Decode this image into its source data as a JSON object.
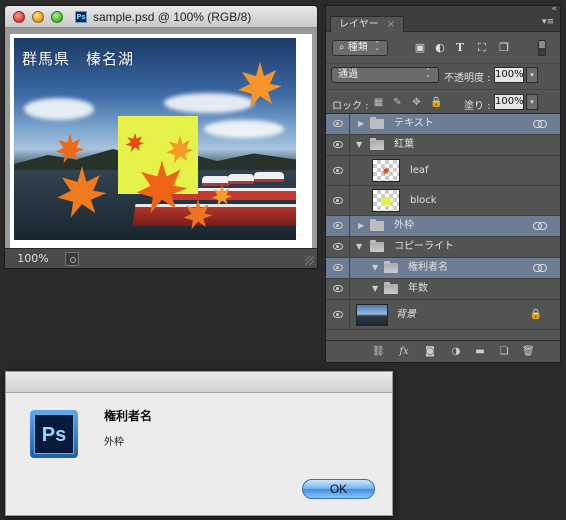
{
  "document_window": {
    "title": "sample.psd @ 100% (RGB/8)",
    "ps_icon_text": "Ps",
    "canvas_caption": "群馬県　榛名湖",
    "zoom": "100%"
  },
  "layers_panel": {
    "tab_label": "レイヤー",
    "tab_close": "×",
    "collapse_label": "«",
    "menu_label": "▾≡",
    "filter_kind": "種類",
    "blend_mode": "通過",
    "opacity_label": "不透明度 :",
    "opacity_value": "100%",
    "lock_label": "ロック :",
    "fill_label": "塗り :",
    "fill_value": "100%",
    "layers": [
      {
        "name": "テキスト",
        "type": "group",
        "expanded": false,
        "selected": true,
        "linked": true
      },
      {
        "name": "紅葉",
        "type": "group",
        "expanded": true,
        "selected": false,
        "linked": false
      },
      {
        "name": "leaf",
        "type": "layer",
        "thumbnail": "leaf-thumb-icon"
      },
      {
        "name": "block",
        "type": "layer",
        "thumbnail": "block-thumb-icon"
      },
      {
        "name": "外枠",
        "type": "group",
        "expanded": false,
        "selected": true,
        "linked": true
      },
      {
        "name": "コピーライト",
        "type": "group",
        "expanded": true,
        "selected": false,
        "linked": false
      },
      {
        "name": "権利者名",
        "type": "group",
        "expanded": true,
        "selected": true,
        "linked": true
      },
      {
        "name": "年数",
        "type": "group",
        "expanded": true,
        "selected": false,
        "linked": false
      },
      {
        "name": "背景",
        "type": "background",
        "locked": true
      }
    ]
  },
  "dialog": {
    "app_icon_text": "Ps",
    "title": "権利者名",
    "message": "外枠",
    "ok_label": "OK"
  },
  "colors": {
    "selection": "#6d7d93",
    "panel_bg": "#535353",
    "block_yellow": "#e6f24a",
    "leaf_orange": "#f08a1c"
  }
}
